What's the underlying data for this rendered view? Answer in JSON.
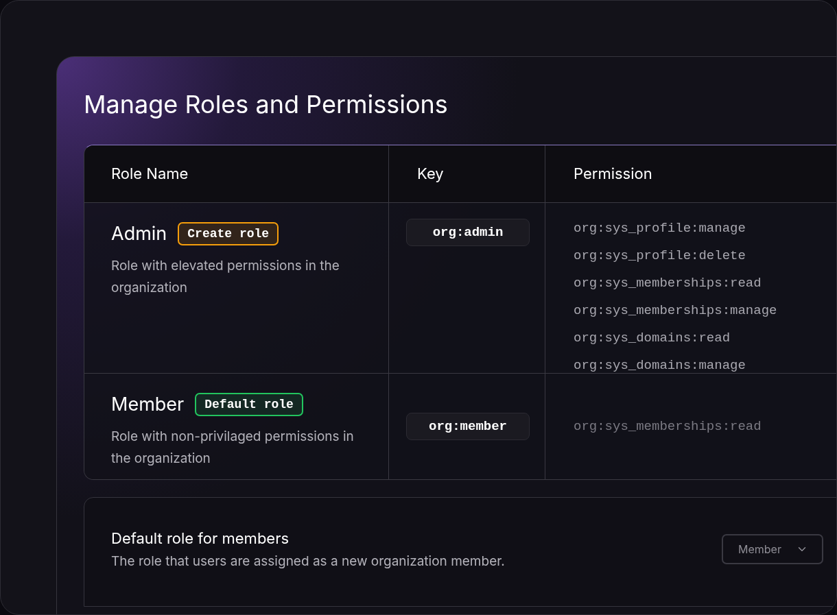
{
  "title": "Manage Roles and Permissions",
  "table": {
    "columns": [
      "Role Name",
      "Key",
      "Permission"
    ],
    "rows": [
      {
        "name": "Admin",
        "badge": {
          "text": "Create role",
          "color": "#f59e0b"
        },
        "description": "Role with elevated permissions in the organization",
        "key": "org:admin",
        "permissions": [
          "org:sys_profile:manage",
          "org:sys_profile:delete",
          "org:sys_memberships:read",
          "org:sys_memberships:manage",
          "org:sys_domains:read",
          "org:sys_domains:manage"
        ]
      },
      {
        "name": "Member",
        "badge": {
          "text": "Default role",
          "color": "#22c55e"
        },
        "description": "Role with non-privilaged permissions in the organization",
        "key": "org:member",
        "permissions": [
          "org:sys_memberships:read"
        ]
      }
    ]
  },
  "default_role": {
    "title": "Default role for members",
    "description": "The role that users are assigned as a new organization member.",
    "value": "Member"
  }
}
